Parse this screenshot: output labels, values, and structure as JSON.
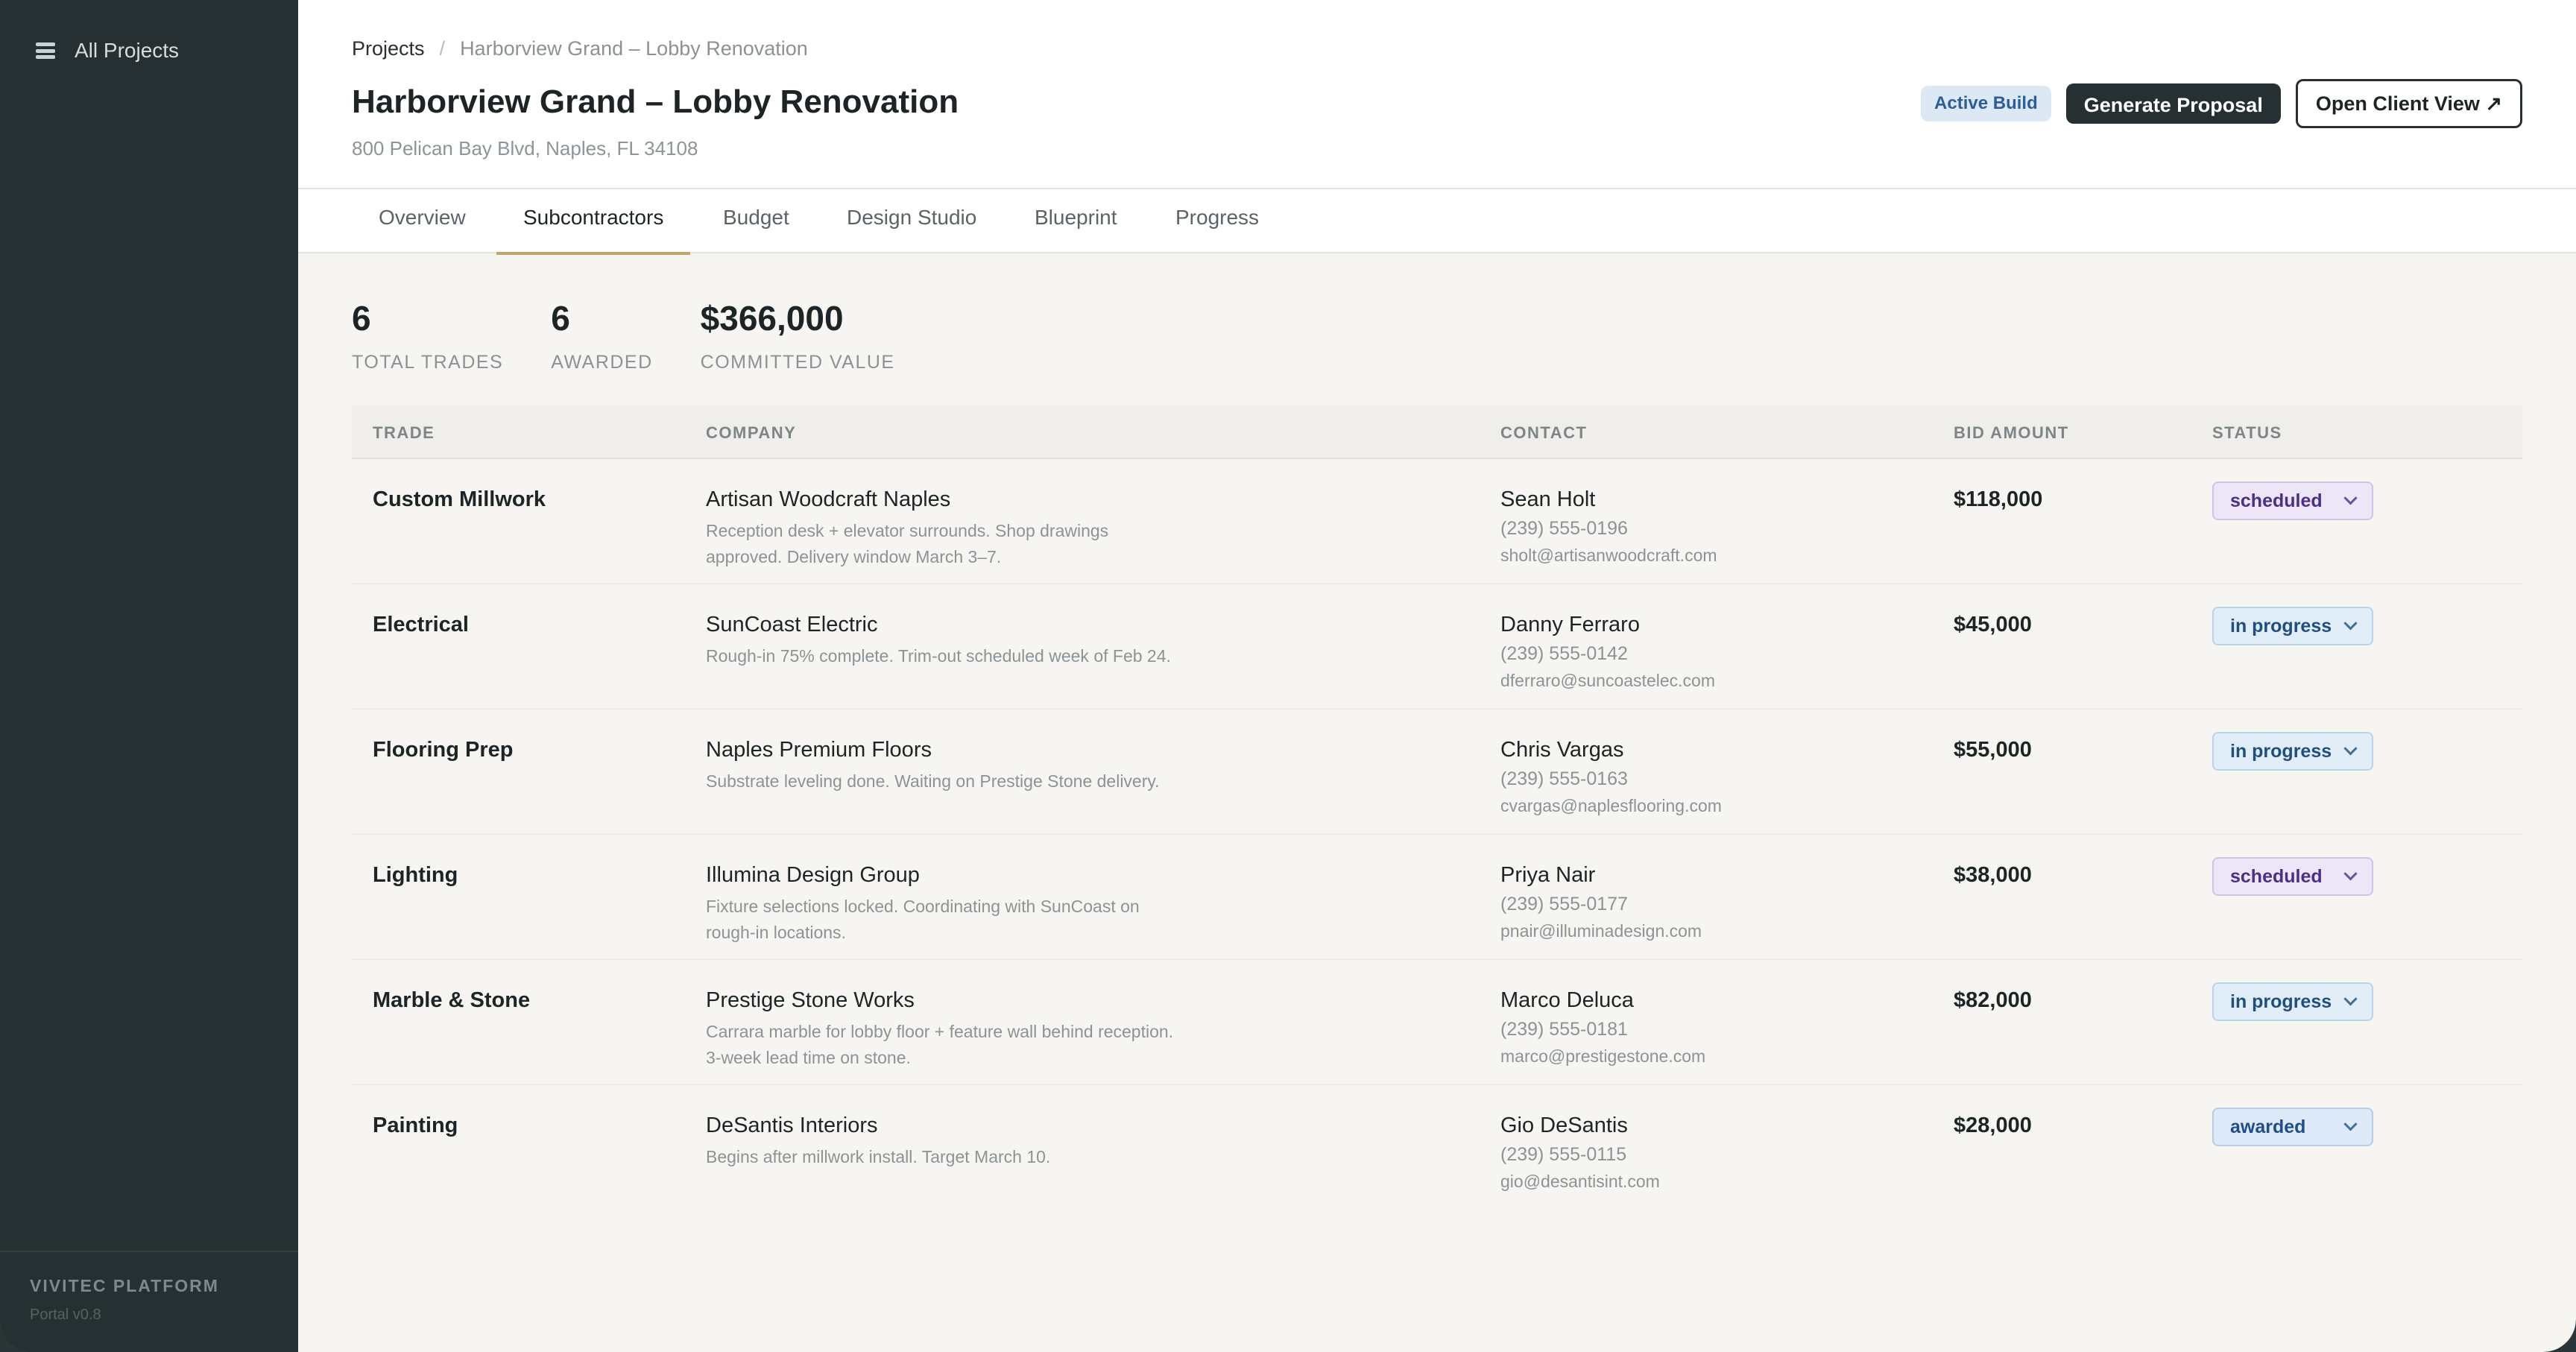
{
  "sidebar": {
    "top_label": "All Projects",
    "footer": {
      "platform": "VIVITEC PLATFORM",
      "version": "Portal v0.8"
    }
  },
  "breadcrumb": {
    "root": "Projects",
    "separator": "/",
    "current": "Harborview Grand – Lobby Renovation"
  },
  "page": {
    "title": "Harborview Grand – Lobby Renovation",
    "address": "800 Pelican Bay Blvd, Naples, FL 34108"
  },
  "header_actions": {
    "status_badge": "Active Build",
    "generate_label": "Generate Proposal",
    "client_view_label": "Open Client View ↗"
  },
  "tabs": [
    "Overview",
    "Subcontractors",
    "Budget",
    "Design Studio",
    "Blueprint",
    "Progress"
  ],
  "active_tab": "Subcontractors",
  "stats": [
    {
      "value": "6",
      "label": "TOTAL TRADES"
    },
    {
      "value": "6",
      "label": "AWARDED"
    },
    {
      "value": "$366,000",
      "label": "COMMITTED VALUE"
    }
  ],
  "table": {
    "headers": [
      "TRADE",
      "COMPANY",
      "CONTACT",
      "BID AMOUNT",
      "STATUS"
    ],
    "rows": [
      {
        "trade": "Custom Millwork",
        "company": "Artisan Woodcraft Naples",
        "note": "Reception desk + elevator surrounds. Shop drawings approved. Delivery window March 3–7.",
        "contact": "Sean Holt",
        "phone": "(239) 555-0196",
        "email": "sholt@artisanwoodcraft.com",
        "bid": "$118,000",
        "status": "scheduled"
      },
      {
        "trade": "Electrical",
        "company": "SunCoast Electric",
        "note": "Rough-in 75% complete. Trim-out scheduled week of Feb 24.",
        "contact": "Danny Ferraro",
        "phone": "(239) 555-0142",
        "email": "dferraro@suncoastelec.com",
        "bid": "$45,000",
        "status": "in progress"
      },
      {
        "trade": "Flooring Prep",
        "company": "Naples Premium Floors",
        "note": "Substrate leveling done. Waiting on Prestige Stone delivery.",
        "contact": "Chris Vargas",
        "phone": "(239) 555-0163",
        "email": "cvargas@naplesflooring.com",
        "bid": "$55,000",
        "status": "in progress"
      },
      {
        "trade": "Lighting",
        "company": "Illumina Design Group",
        "note": "Fixture selections locked. Coordinating with SunCoast on rough-in locations.",
        "contact": "Priya Nair",
        "phone": "(239) 555-0177",
        "email": "pnair@illuminadesign.com",
        "bid": "$38,000",
        "status": "scheduled"
      },
      {
        "trade": "Marble & Stone",
        "company": "Prestige Stone Works",
        "note": "Carrara marble for lobby floor + feature wall behind reception. 3-week lead time on stone.",
        "contact": "Marco Deluca",
        "phone": "(239) 555-0181",
        "email": "marco@prestigestone.com",
        "bid": "$82,000",
        "status": "in progress"
      },
      {
        "trade": "Painting",
        "company": "DeSantis Interiors",
        "note": "Begins after millwork install. Target March 10.",
        "contact": "Gio DeSantis",
        "phone": "(239) 555-0115",
        "email": "gio@desantisint.com",
        "bid": "$28,000",
        "status": "awarded"
      }
    ]
  }
}
